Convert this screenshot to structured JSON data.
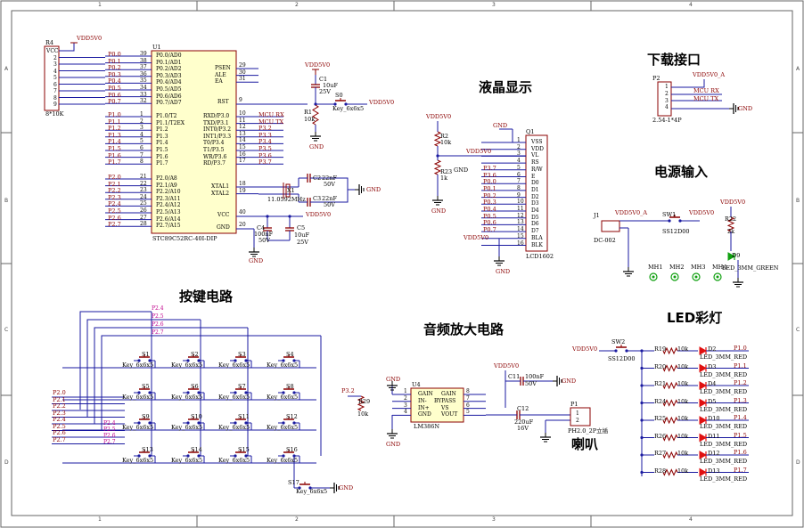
{
  "zones": {
    "cols": [
      "1",
      "2",
      "3",
      "4"
    ],
    "rows": [
      "A",
      "B",
      "C",
      "D"
    ]
  },
  "headings": {
    "download": "下载接口",
    "lcd": "液晶显示",
    "power": "电源输入",
    "keys": "按键电路",
    "audio": "音频放大电路",
    "led": "LED彩灯",
    "speaker": "喇叭"
  },
  "mcu": {
    "ref": "U1",
    "part": "STC89C52RC-40I-DIP",
    "left_top": [
      {
        "net": "P0.0",
        "num": "39",
        "pin": "P0.0/AD0"
      },
      {
        "net": "P0.1",
        "num": "38",
        "pin": "P0.1/AD1"
      },
      {
        "net": "P0.2",
        "num": "37",
        "pin": "P0.2/AD2"
      },
      {
        "net": "P0.3",
        "num": "36",
        "pin": "P0.3/AD3"
      },
      {
        "net": "P0.4",
        "num": "35",
        "pin": "P0.4/AD4"
      },
      {
        "net": "P0.5",
        "num": "34",
        "pin": "P0.5/AD5"
      },
      {
        "net": "P0.6",
        "num": "33",
        "pin": "P0.6/AD6"
      },
      {
        "net": "P0.7",
        "num": "32",
        "pin": "P0.7/AD7"
      }
    ],
    "left_mid": [
      {
        "net": "P1.0",
        "num": "1",
        "pin": "P1.0/T2"
      },
      {
        "net": "P1.1",
        "num": "2",
        "pin": "P1.1/T2EX"
      },
      {
        "net": "P1.2",
        "num": "3",
        "pin": "P1.2"
      },
      {
        "net": "P1.3",
        "num": "4",
        "pin": "P1.3"
      },
      {
        "net": "P1.4",
        "num": "5",
        "pin": "P1.4"
      },
      {
        "net": "P1.5",
        "num": "6",
        "pin": "P1.5"
      },
      {
        "net": "P1.6",
        "num": "7",
        "pin": "P1.6"
      },
      {
        "net": "P1.7",
        "num": "8",
        "pin": "P1.7"
      }
    ],
    "left_bot": [
      {
        "net": "P2.0",
        "num": "21",
        "pin": "P2.0/A8"
      },
      {
        "net": "P2.1",
        "num": "22",
        "pin": "P2.1/A9"
      },
      {
        "net": "P2.2",
        "num": "23",
        "pin": "P2.2/A10"
      },
      {
        "net": "P2.3",
        "num": "24",
        "pin": "P2.3/A11"
      },
      {
        "net": "P2.4",
        "num": "25",
        "pin": "P2.4/A12"
      },
      {
        "net": "P2.5",
        "num": "26",
        "pin": "P2.5/A13"
      },
      {
        "net": "P2.6",
        "num": "27",
        "pin": "P2.6/A14"
      },
      {
        "net": "P2.7",
        "num": "28",
        "pin": "P2.7/A15"
      }
    ],
    "right_top": [
      {
        "num": "29",
        "pin": "PSEN"
      },
      {
        "num": "30",
        "pin": "ALE"
      },
      {
        "num": "31",
        "pin": "EA"
      }
    ],
    "rst": {
      "num": "9",
      "pin": "RST"
    },
    "right_p3": [
      {
        "net": "MCU RX",
        "num": "10",
        "pin": "RXD/P3.0"
      },
      {
        "net": "MCU TX",
        "num": "11",
        "pin": "TXD/P3.1"
      },
      {
        "net": "P3.2",
        "num": "12",
        "pin": "INT0/P3.2"
      },
      {
        "net": "P3.3",
        "num": "13",
        "pin": "INT1/P3.3"
      },
      {
        "net": "P3.4",
        "num": "14",
        "pin": "T0/P3.4"
      },
      {
        "net": "P3.5",
        "num": "15",
        "pin": "T1/P3.5"
      },
      {
        "net": "P3.6",
        "num": "16",
        "pin": "WR/P3.6"
      },
      {
        "net": "P3.7",
        "num": "17",
        "pin": "RD/P3.7"
      }
    ],
    "xtal": [
      {
        "num": "18",
        "pin": "XTAL1"
      },
      {
        "num": "19",
        "pin": "XTAL2"
      }
    ],
    "vcc": {
      "num": "40",
      "pin": "VCC"
    },
    "gnd": {
      "num": "20",
      "pin": "GND"
    }
  },
  "rpack": {
    "ref": "R4",
    "value": "8*10K",
    "power": "VDD5V0",
    "pins": [
      "VCC",
      "2",
      "3",
      "4",
      "5",
      "6",
      "7",
      "8",
      "9"
    ]
  },
  "reset": {
    "power": "VDD5V0",
    "cap_ref": "C1",
    "cap_val": "10uF",
    "cap_volt": "25V",
    "sw_ref": "S0",
    "sw_val": "Key_6x6x5",
    "sw_power": "VDD5V0",
    "r_ref": "R1",
    "r_val": "10k",
    "gnd": "GND"
  },
  "crystal": {
    "c2_ref": "C2",
    "c2_val": "22nF",
    "c2_volt": "50V",
    "c3_ref": "C3",
    "c3_val": "22nF",
    "c3_volt": "50V",
    "x_ref": "X1",
    "x_val": "11.0592MHz",
    "gnd": "GND"
  },
  "decoupling": {
    "power": "VDD5V0",
    "c4_ref": "C4",
    "c4_val": "100nF",
    "c4_volt": "50V",
    "c5_ref": "C5",
    "c5_val": "10uF",
    "c5_volt": "25V",
    "gnd": "GND"
  },
  "lcd": {
    "ref": "Q1",
    "part": "LCD1602",
    "power1": "VDD5V0",
    "power2": "VDD5V0",
    "power3": "VDD5V0",
    "r2_ref": "R2",
    "r2_val": "10k",
    "r23_ref": "R23",
    "r23_val": "1k",
    "gnd_label": "GND",
    "gnd": "GND",
    "pins": [
      {
        "num": "1",
        "name": "VSS",
        "net": ""
      },
      {
        "num": "2",
        "name": "VDD",
        "net": ""
      },
      {
        "num": "3",
        "name": "VL",
        "net": ""
      },
      {
        "num": "4",
        "name": "RS",
        "net": ""
      },
      {
        "num": "5",
        "name": "R/W",
        "net": "P3.7"
      },
      {
        "num": "6",
        "name": "E",
        "net": "P3.6"
      },
      {
        "num": "7",
        "name": "D0",
        "net": "P0.0"
      },
      {
        "num": "8",
        "name": "D1",
        "net": "P0.1"
      },
      {
        "num": "9",
        "name": "D2",
        "net": "P0.2"
      },
      {
        "num": "10",
        "name": "D3",
        "net": "P0.3"
      },
      {
        "num": "11",
        "name": "D4",
        "net": "P0.4"
      },
      {
        "num": "12",
        "name": "D5",
        "net": "P0.5"
      },
      {
        "num": "13",
        "name": "D6",
        "net": "P0.6"
      },
      {
        "num": "14",
        "name": "D7",
        "net": "P0.7"
      },
      {
        "num": "15",
        "name": "BLA",
        "net": ""
      },
      {
        "num": "16",
        "name": "BLK",
        "net": ""
      }
    ]
  },
  "download": {
    "ref": "P2",
    "part": "2.54-1*4P",
    "power": "VDD5V0_A",
    "nets": [
      "MCU TX",
      "MCU RX"
    ],
    "gnd": "GND",
    "pins": [
      "1",
      "2",
      "3",
      "4"
    ]
  },
  "power": {
    "j_ref": "J1",
    "j_part": "DC-002",
    "net_a": "VDD5V0_A",
    "sw_ref": "SW1",
    "sw_part": "SS12D00",
    "out": "VDD5V0",
    "led_power": "VDD5V0",
    "r_ref": "R22",
    "r_val": "2k",
    "d_ref": "D9",
    "d_part": "LED_3MM_GREEN",
    "holes": [
      "MH1",
      "MH2",
      "MH3",
      "MH4"
    ]
  },
  "keys": {
    "row_labels": [
      "P2.0",
      "P2.1",
      "P2.2",
      "P2.3",
      "P2.4",
      "P2.5",
      "P2.6",
      "P2.7"
    ],
    "col_labels": [
      "P2.4",
      "P2.5",
      "P2.6",
      "P2.7"
    ],
    "left_col_labels": [
      "P2.4",
      "P2.5",
      "P2.6",
      "P2.7"
    ],
    "part": "Key_6x6x5",
    "switches": [
      "S1",
      "S2",
      "S3",
      "S4",
      "S5",
      "S6",
      "S7",
      "S8",
      "S9",
      "S10",
      "S11",
      "S12",
      "S13",
      "S14",
      "S15",
      "S16"
    ],
    "extra": {
      "ref": "S17",
      "part": "Key_6x6x5",
      "gnd": "GND"
    }
  },
  "audio": {
    "in_net": "P3.2",
    "r_ref": "R29",
    "r_val": "10k",
    "ic_ref": "U4",
    "ic_part": "LM386N",
    "ic_pins_left": [
      "GAIN",
      "IN-",
      "IN+",
      "GND"
    ],
    "ic_pins_right": [
      "GAIN",
      "BYPASS",
      "VS",
      "VOUT"
    ],
    "pin_nums_left": [
      "1",
      "2",
      "3",
      "4"
    ],
    "pin_nums_right": [
      "8",
      "7",
      "6",
      "5"
    ],
    "power": "VDD5V0",
    "c11_ref": "C11",
    "c11_val": "100nF",
    "c11_volt": "50V",
    "c12_ref": "C12",
    "c12_val": "220uF",
    "c12_volt": "16V",
    "gnd": "GND"
  },
  "speaker": {
    "ref": "P1",
    "part": "PH2.0_2P立插",
    "pins": [
      "1",
      "2"
    ]
  },
  "leds": {
    "power": "VDD5V0",
    "sw_ref": "SW2",
    "sw_part": "SS12D00",
    "items": [
      {
        "r": "R19",
        "rv": "10k",
        "d": "D2",
        "part": "LED_3MM_RED",
        "net": "P1.0"
      },
      {
        "r": "R20",
        "rv": "10k",
        "d": "D3",
        "part": "LED_3MM_RED",
        "net": "P1.1"
      },
      {
        "r": "R21",
        "rv": "10k",
        "d": "D4",
        "part": "LED_3MM_RED",
        "net": "P1.2"
      },
      {
        "r": "R24",
        "rv": "10k",
        "d": "D5",
        "part": "LED_3MM_RED",
        "net": "P1.3"
      },
      {
        "r": "R25",
        "rv": "10k",
        "d": "D10",
        "part": "LED_3MM_RED",
        "net": "P1.4"
      },
      {
        "r": "R26",
        "rv": "10k",
        "d": "D11",
        "part": "LED_3MM_RED",
        "net": "P1.5"
      },
      {
        "r": "R27",
        "rv": "10k",
        "d": "D12",
        "part": "LED_3MM_RED",
        "net": "P1.6"
      },
      {
        "r": "R28",
        "rv": "10k",
        "d": "D13",
        "part": "LED_3MM_RED",
        "net": "P1.7"
      }
    ]
  },
  "colors": {
    "wire": "#1a1aa0",
    "component": "#8b0000",
    "chip_fill": "#ffffcc",
    "led_red": "#e01010",
    "led_green": "#10a010",
    "gnd": "#000000"
  }
}
